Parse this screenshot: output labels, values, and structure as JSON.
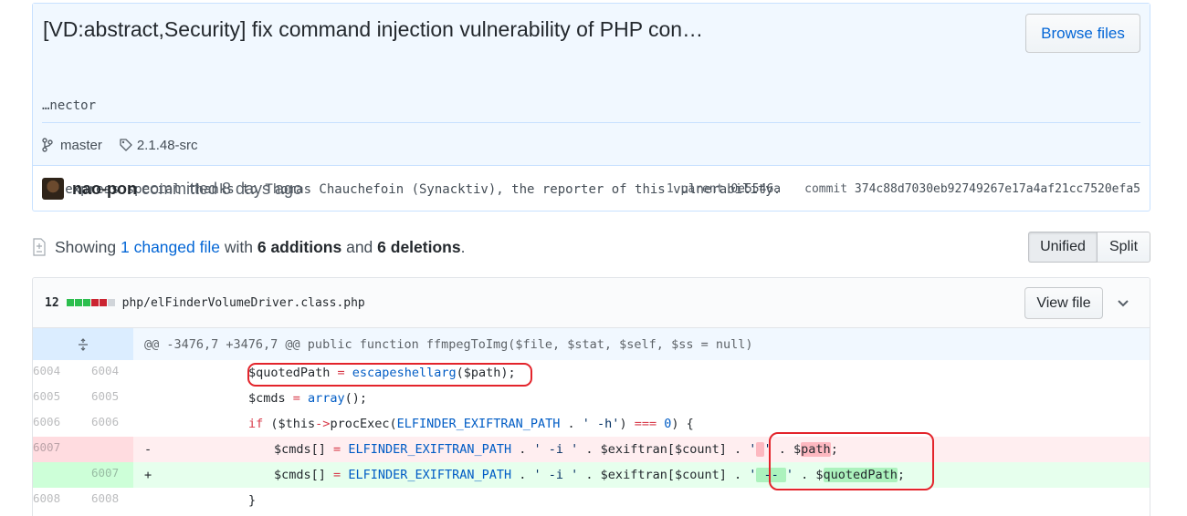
{
  "commit": {
    "title": "[VD:abstract,Security] fix command injection vulnerability of PHP con…",
    "body_line1": "…nector",
    "body_line2": "We express special thanks to Thomas Chauchefoin (Synacktiv), the reporter of this vulnerability.",
    "browse_label": "Browse files",
    "branch": "master",
    "tag": "2.1.48-src",
    "author": "nao-pon",
    "committed_text": "committed 8 days ago",
    "parent_label": "1 parent",
    "parent_sha": "0e5546a",
    "commit_label": "commit",
    "commit_sha": "374c88d7030eb92749267e17a4af21cc7520efa5"
  },
  "summary": {
    "prefix": "Showing ",
    "changed": "1 changed file",
    "mid": " with ",
    "additions": "6 additions",
    "and": " and ",
    "deletions": "6 deletions",
    "end": ".",
    "unified_label": "Unified",
    "split_label": "Split"
  },
  "file": {
    "count": "12",
    "name": "php/elFinderVolumeDriver.class.php",
    "view_label": "View file",
    "diffstat": [
      "#2cbe4e",
      "#2cbe4e",
      "#2cbe4e",
      "#cb2431",
      "#cb2431",
      "#d1d5da"
    ],
    "hunk_header": "@@ -3476,7 +3476,7 @@ public function ffmpegToImg($file, $stat, $self, $ss = null)",
    "lines": [
      {
        "old": "6004",
        "new": "6004",
        "type": "ctx",
        "mark": ""
      },
      {
        "old": "6005",
        "new": "6005",
        "type": "ctx",
        "mark": ""
      },
      {
        "old": "6006",
        "new": "6006",
        "type": "ctx",
        "mark": ""
      },
      {
        "old": "6007",
        "new": "",
        "type": "del",
        "mark": "-"
      },
      {
        "old": "",
        "new": "6007",
        "type": "add",
        "mark": "+"
      },
      {
        "old": "6008",
        "new": "6008",
        "type": "ctx",
        "mark": ""
      }
    ],
    "code": {
      "l1_var": "$quotedPath",
      "l1_eq": " = ",
      "l1_fn": "escapeshellarg",
      "l1_rest": "($path);",
      "l2_var": "$cmds",
      "l2_eq": " = ",
      "l2_fn": "array",
      "l2_rest": "();",
      "l3_kw": "if",
      "l3_a": " ($this",
      "l3_arrow": "->",
      "l3_b": "procExec(",
      "l3_const": "ELFINDER_EXIFTRAN_PATH",
      "l3_c": " . ",
      "l3_str": "' -h'",
      "l3_d": ") ",
      "l3_op": "===",
      "l3_e": " ",
      "l3_num": "0",
      "l3_f": ") {",
      "d_a": "$cmds[] ",
      "d_eq": "=",
      "d_sp": " ",
      "d_const": "ELFINDER_EXIFTRAN_PATH",
      "d_b": " . ",
      "d_str1": "' -i '",
      "d_c": " . $exiftran[$count] . ",
      "d_q1": "'",
      "d_hl": " ",
      "d_q2": "'",
      "d_d": " . $",
      "d_var": "path",
      "d_e": ";",
      "a_a": "$cmds[] ",
      "a_eq": "=",
      "a_sp": " ",
      "a_const": "ELFINDER_EXIFTRAN_PATH",
      "a_b": " . ",
      "a_str1": "' -i '",
      "a_c": " . $exiftran[$count] . ",
      "a_q1": "'",
      "a_hl": " -- ",
      "a_q2": "'",
      "a_d": " . $",
      "a_var": "quotedPath",
      "a_e": ";",
      "l6": "}"
    }
  }
}
